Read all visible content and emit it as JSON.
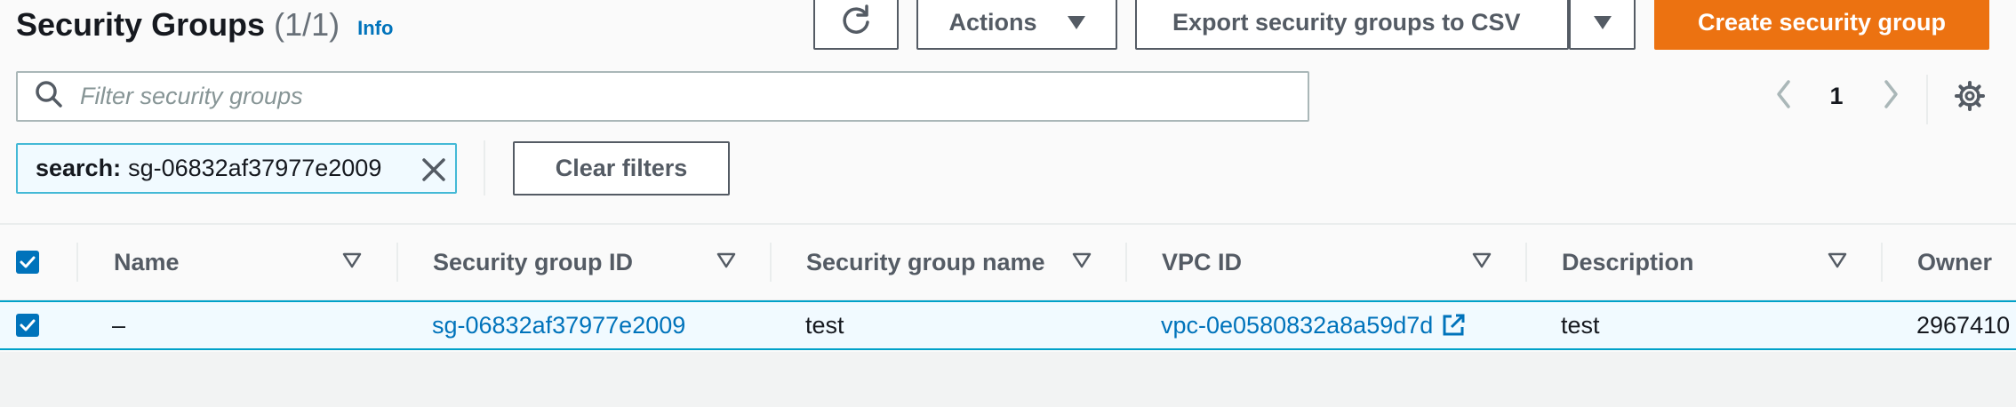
{
  "header": {
    "title": "Security Groups",
    "count": "(1/1)",
    "info_label": "Info"
  },
  "toolbar": {
    "refresh_icon": "refresh-icon",
    "actions_label": "Actions",
    "export_label": "Export security groups to CSV",
    "create_label": "Create security group"
  },
  "search": {
    "placeholder": "Filter security groups",
    "value": ""
  },
  "pagination": {
    "current_page": "1"
  },
  "filter_token": {
    "key": "search:",
    "value": "sg-06832af37977e2009"
  },
  "clear_filters_label": "Clear filters",
  "table": {
    "columns": [
      "Name",
      "Security group ID",
      "Security group name",
      "VPC ID",
      "Description",
      "Owner"
    ],
    "rows": [
      {
        "selected": true,
        "name": "–",
        "security_group_id": "sg-06832af37977e2009",
        "security_group_name": "test",
        "vpc_id": "vpc-0e0580832a8a59d7d",
        "description": "test",
        "owner": "2967410"
      }
    ]
  },
  "colors": {
    "accent": "#0073bb",
    "primary_button": "#ec7211",
    "selection_bg": "#f1faff",
    "selection_border": "#00a1c9"
  }
}
